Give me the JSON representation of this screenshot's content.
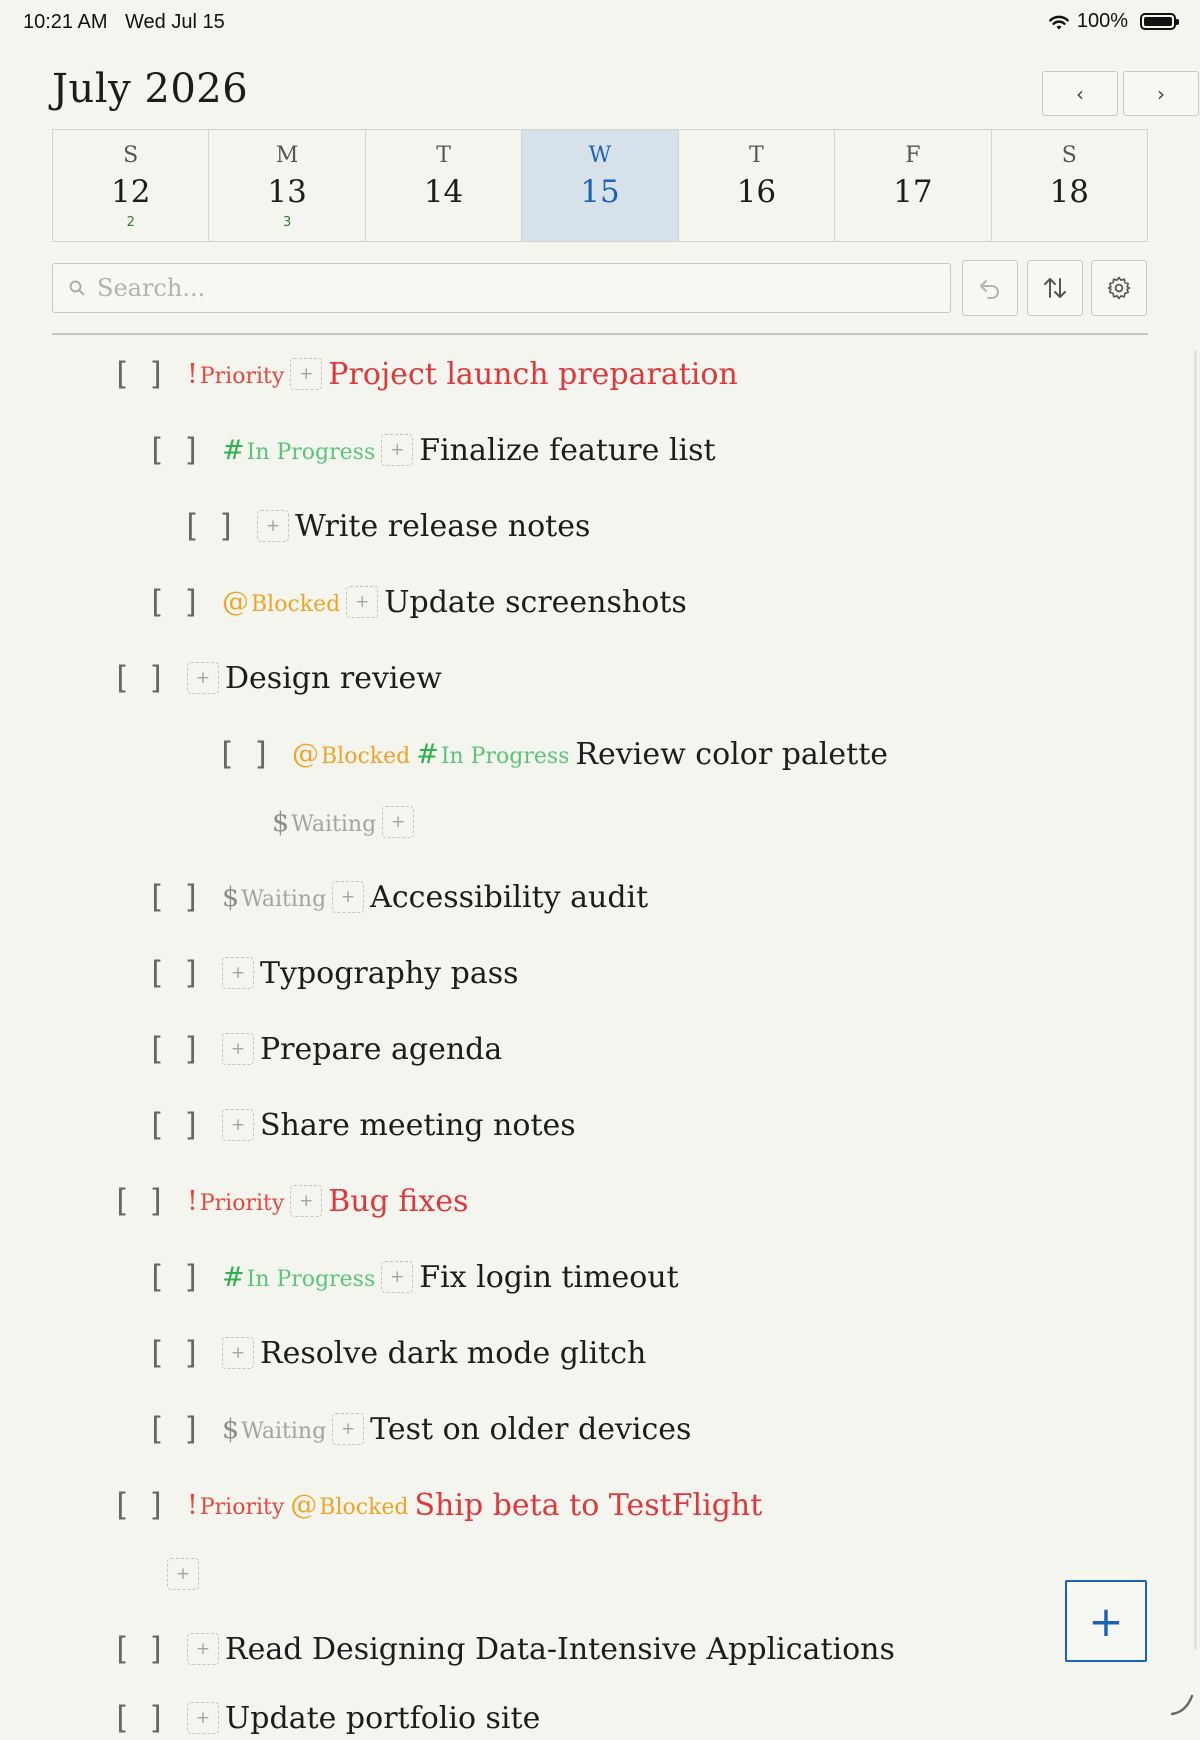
{
  "status_bar": {
    "time": "10:21 AM",
    "date": "Wed Jul 15",
    "battery": "100%"
  },
  "header": {
    "month_title": "July 2026",
    "prev_label": "‹",
    "next_label": "›"
  },
  "week": [
    {
      "letter": "S",
      "num": "12",
      "count": "2",
      "selected": false
    },
    {
      "letter": "M",
      "num": "13",
      "count": "3",
      "selected": false
    },
    {
      "letter": "T",
      "num": "14",
      "count": "",
      "selected": false
    },
    {
      "letter": "W",
      "num": "15",
      "count": "",
      "selected": true
    },
    {
      "letter": "T",
      "num": "16",
      "count": "",
      "selected": false
    },
    {
      "letter": "F",
      "num": "17",
      "count": "",
      "selected": false
    },
    {
      "letter": "S",
      "num": "18",
      "count": "",
      "selected": false
    }
  ],
  "search": {
    "placeholder": "Search..."
  },
  "tag_labels": {
    "priority_symbol": "!",
    "priority": "Priority",
    "progress_symbol": "#",
    "progress": "In Progress",
    "blocked_symbol": "@",
    "blocked": "Blocked",
    "waiting_symbol": "$",
    "waiting": "Waiting",
    "add": "+",
    "checkbox": "[ ]"
  },
  "tasks": [
    {
      "title": "Project launch preparation"
    },
    {
      "title": "Finalize feature list"
    },
    {
      "title": "Write release notes"
    },
    {
      "title": "Update screenshots"
    },
    {
      "title": "Design review"
    },
    {
      "title": "Review color palette"
    },
    {
      "title": "Accessibility audit"
    },
    {
      "title": "Typography pass"
    },
    {
      "title": "Prepare agenda"
    },
    {
      "title": "Share meeting notes"
    },
    {
      "title": "Bug fixes"
    },
    {
      "title": "Fix login timeout"
    },
    {
      "title": "Resolve dark mode glitch"
    },
    {
      "title": "Test on older devices"
    },
    {
      "title": "Ship beta to TestFlight"
    },
    {
      "title": "Read Designing Data-Intensive Applications"
    },
    {
      "title": "Update portfolio site"
    }
  ],
  "fab_label": "+",
  "colors": {
    "priority": "#e5463d",
    "in_progress": "#2fb150",
    "blocked": "#f0a425",
    "waiting": "#a3a3a3",
    "accent": "#1b63b8",
    "selected_day_bg": "#d7e1e9"
  }
}
